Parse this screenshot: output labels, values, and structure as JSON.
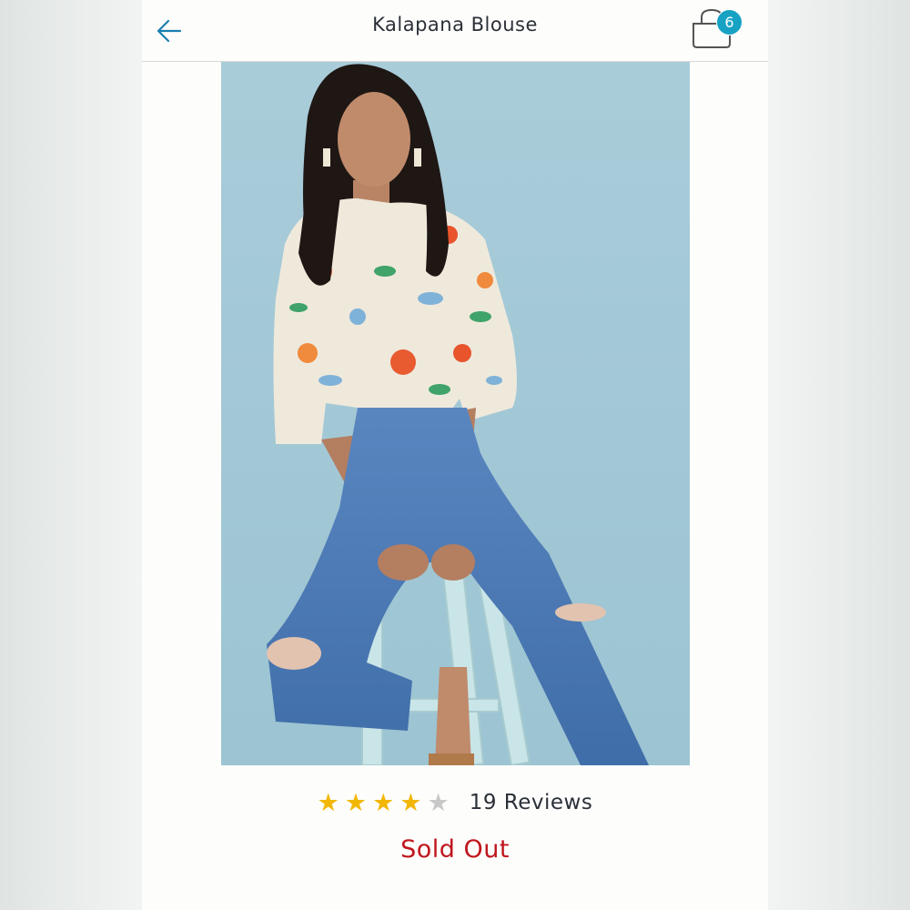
{
  "header": {
    "title": "Kalapana Blouse",
    "back_icon": "back-arrow-icon",
    "bag_icon": "shopping-bag-icon",
    "bag_count": "6"
  },
  "product": {
    "image_icon": "product-photo",
    "rating": 4,
    "rating_max": 5,
    "reviews_label": "19 Reviews",
    "status": "Sold Out"
  },
  "colors": {
    "accent": "#17a2c4",
    "star_filled": "#f2b705",
    "star_empty": "#c8c8c8",
    "sold_out": "#c0161e",
    "text": "#2b3038"
  }
}
